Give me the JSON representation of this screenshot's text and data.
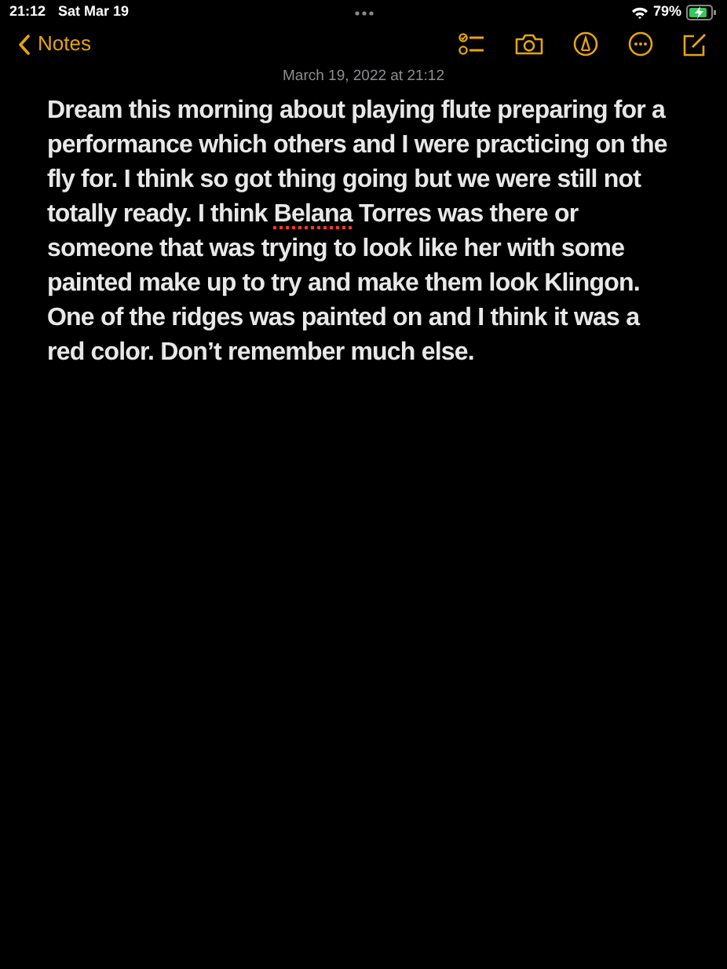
{
  "status_bar": {
    "time": "21:12",
    "date": "Sat Mar 19",
    "battery": "79%"
  },
  "toolbar": {
    "back_label": "Notes"
  },
  "note": {
    "timestamp": "March 19, 2022 at 21:12",
    "segments": [
      {
        "text": "Dream this morning about playing flute preparing for a performance which others and I were practicing on the fly for. I think so got thing going but we were still not totally ready. I think ",
        "misspelled": false
      },
      {
        "text": "Belana",
        "misspelled": true
      },
      {
        "text": " Torres was there or someone that was trying to look like her with some painted make up to try and make them look Klingon. One of the ridges was painted on and I think it was a red color. Don’t remember much else.",
        "misspelled": false
      }
    ]
  }
}
